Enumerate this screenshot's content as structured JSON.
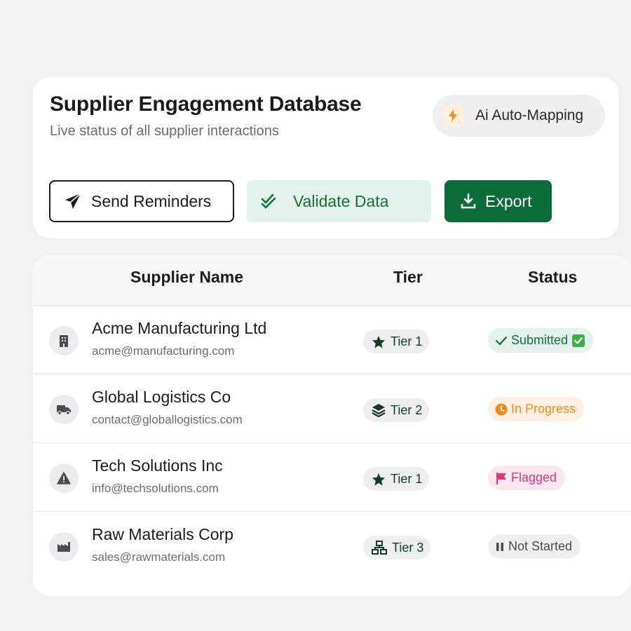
{
  "header": {
    "title": "Supplier Engagement Database",
    "subtitle": "Live status of all supplier interactions",
    "ai_button": {
      "label": "Ai Auto-Mapping",
      "icon": "lightning-bolt-icon"
    }
  },
  "actions": {
    "send_reminders": {
      "label": "Send Reminders",
      "icon": "paper-plane-icon"
    },
    "validate_data": {
      "label": "Validate Data",
      "icon": "double-check-icon"
    },
    "export": {
      "label": "Export",
      "icon": "download-icon"
    }
  },
  "table": {
    "columns": [
      "Supplier Name",
      "Tier",
      "Status"
    ],
    "rows": [
      {
        "name": "Acme Manufacturing Ltd",
        "email": "acme@manufacturing.com",
        "icon": "building-icon",
        "tier": "Tier 1",
        "tier_icon": "star-icon",
        "status": "Submitted",
        "status_icon": "check-icon",
        "status_emoji": "check-mark-button"
      },
      {
        "name": "Global Logistics Co",
        "email": "contact@globallogistics.com",
        "icon": "truck-icon",
        "tier": "Tier 2",
        "tier_icon": "layers-icon",
        "status": "In Progress",
        "status_icon": "clock-icon"
      },
      {
        "name": "Tech Solutions Inc",
        "email": "info@techsolutions.com",
        "icon": "warning-icon",
        "tier": "Tier 1",
        "tier_icon": "star-icon",
        "status": "Flagged",
        "status_icon": "flag-icon"
      },
      {
        "name": "Raw Materials Corp",
        "email": "sales@rawmaterials.com",
        "icon": "factory-icon",
        "tier": "Tier 3",
        "tier_icon": "hierarchy-icon",
        "status": "Not Started",
        "status_icon": "pause-icon"
      }
    ]
  },
  "colors": {
    "primary_green": "#0b6b39",
    "light_green": "#e4f2ed",
    "orange": "#f08c1c",
    "pink": "#d43a7e",
    "background": "#f1f1f2"
  }
}
